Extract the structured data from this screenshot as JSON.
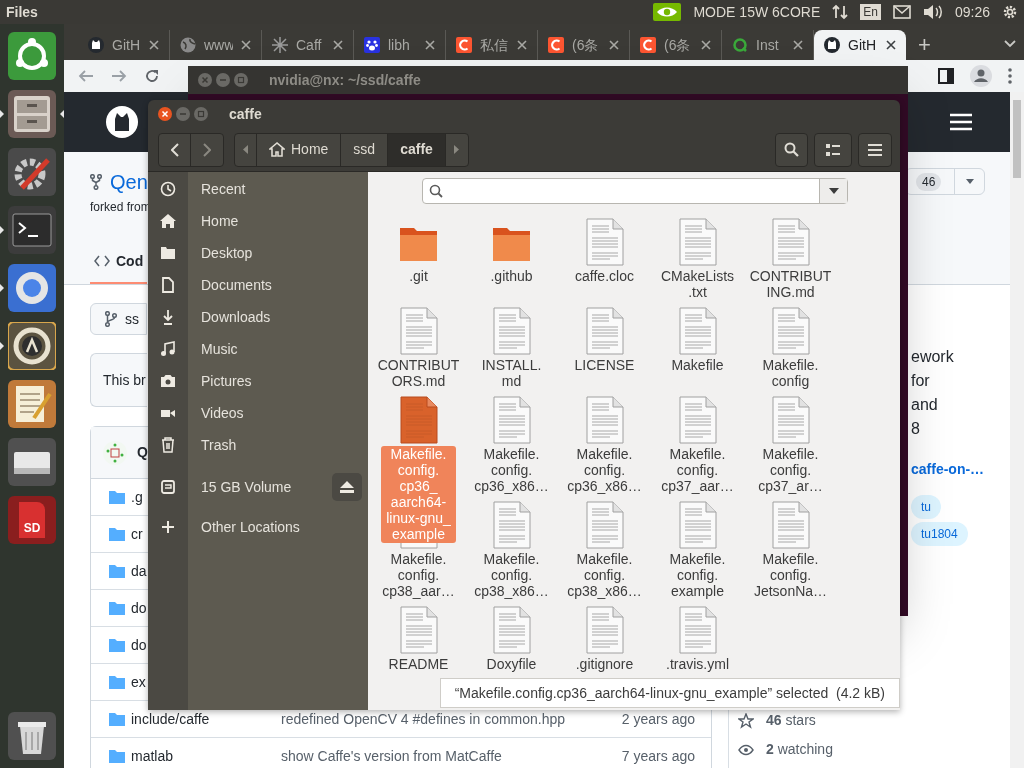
{
  "top_panel": {
    "app_name": "Files",
    "power_mode": "MODE 15W 6CORE",
    "input_method": "En",
    "clock": "09:26"
  },
  "launcher": [
    {
      "kind": "dash",
      "running": false,
      "focused": false
    },
    {
      "kind": "files",
      "running": true,
      "focused": true
    },
    {
      "kind": "settings",
      "running": false,
      "focused": false
    },
    {
      "kind": "terminal",
      "running": true,
      "focused": false
    },
    {
      "kind": "browser",
      "running": true,
      "focused": false
    },
    {
      "kind": "software",
      "running": true,
      "focused": false
    },
    {
      "kind": "editor",
      "running": false,
      "focused": false
    },
    {
      "kind": "drive",
      "running": false,
      "focused": false
    },
    {
      "kind": "sd",
      "label": "SD",
      "running": false,
      "focused": false
    }
  ],
  "browser": {
    "tabs": [
      {
        "title": "GitH",
        "kind": "github",
        "selected": false
      },
      {
        "title": "www",
        "kind": "globe",
        "selected": false
      },
      {
        "title": "Caff",
        "kind": "caffe",
        "selected": false
      },
      {
        "title": "libh",
        "kind": "paw",
        "selected": false
      },
      {
        "title": "私信",
        "kind": "csdn",
        "selected": false
      },
      {
        "title": "(6条",
        "kind": "csdn",
        "selected": false
      },
      {
        "title": "(6条",
        "kind": "csdn",
        "selected": false
      },
      {
        "title": "Inst",
        "kind": "ring",
        "selected": false
      },
      {
        "title": "GitH",
        "kind": "github",
        "selected": true
      }
    ],
    "new_tab": "+",
    "page": {
      "repo_name": "Qen",
      "forked_from": "forked from",
      "code_tab": "Cod",
      "branch": "ss",
      "notice": "This br",
      "commit_author": "Q",
      "files": [
        {
          "name": ".g"
        },
        {
          "name": "cr"
        },
        {
          "name": "da"
        },
        {
          "name": "do"
        },
        {
          "name": "do"
        },
        {
          "name": "ex"
        },
        {
          "name": "include/caffe",
          "message": "redefined OpenCV 4 #defines in common.hpp",
          "age": "2 years ago"
        },
        {
          "name": "matlab",
          "message": "show Caffe's version from MatCaffe",
          "age": "7 years ago"
        }
      ],
      "fork_count": "46",
      "about_lines": [
        "ework",
        "for",
        "and",
        "8"
      ],
      "link": "caffe-on-…",
      "topics": [
        "tu",
        "tu1804"
      ],
      "stars": "**46** stars",
      "watching": "**2** watching"
    }
  },
  "terminal": {
    "title": "nvidia@nx: ~/ssd/caffe"
  },
  "files": {
    "title": "caffe",
    "path": [
      {
        "label": "Home",
        "selected": false
      },
      {
        "label": "ssd",
        "selected": false
      },
      {
        "label": "caffe",
        "selected": true
      }
    ],
    "sidebar": [
      {
        "kind": "recent",
        "label": "Recent"
      },
      {
        "kind": "home",
        "label": "Home"
      },
      {
        "kind": "desktop",
        "label": "Desktop"
      },
      {
        "kind": "documents",
        "label": "Documents"
      },
      {
        "kind": "downloads",
        "label": "Downloads"
      },
      {
        "kind": "music",
        "label": "Music"
      },
      {
        "kind": "pictures",
        "label": "Pictures"
      },
      {
        "kind": "videos",
        "label": "Videos"
      },
      {
        "kind": "trash",
        "label": "Trash"
      },
      {
        "kind": "volume",
        "label": "15 GB Volume"
      },
      {
        "kind": "other",
        "label": "Other Locations"
      }
    ],
    "items": [
      {
        "kind": "folder",
        "label": ".git",
        "selected": false
      },
      {
        "kind": "folder",
        "label": ".github",
        "selected": false
      },
      {
        "kind": "file",
        "label": "caffe.cloc",
        "selected": false
      },
      {
        "kind": "file",
        "label": "CMakeLists\n.txt",
        "selected": false
      },
      {
        "kind": "file",
        "label": "CONTRIBUT\nING.md",
        "selected": false
      },
      {
        "kind": "file",
        "label": "CONTRIBUT\nORS.md",
        "selected": false
      },
      {
        "kind": "file",
        "label": "INSTALL.\nmd",
        "selected": false
      },
      {
        "kind": "file",
        "label": "LICENSE",
        "selected": false
      },
      {
        "kind": "file",
        "label": "Makefile",
        "selected": false
      },
      {
        "kind": "file",
        "label": "Makefile.\nconfig",
        "selected": false
      },
      {
        "kind": "file",
        "label": "Makefile.\nconfig.\ncp36_\naarch64-\nlinux-gnu_\nexample",
        "selected": true
      },
      {
        "kind": "file",
        "label": "Makefile.\nconfig.\ncp36_x86…",
        "selected": false
      },
      {
        "kind": "file",
        "label": "Makefile.\nconfig.\ncp36_x86…",
        "selected": false
      },
      {
        "kind": "file",
        "label": "Makefile.\nconfig.\ncp37_aar…",
        "selected": false
      },
      {
        "kind": "file",
        "label": "Makefile.\nconfig.\ncp37_ar…",
        "selected": false
      },
      {
        "kind": "file",
        "label": "Makefile.\nconfig.\ncp38_aar…",
        "selected": false
      },
      {
        "kind": "file",
        "label": "Makefile.\nconfig.\ncp38_x86…",
        "selected": false
      },
      {
        "kind": "file",
        "label": "Makefile.\nconfig.\ncp38_x86…",
        "selected": false
      },
      {
        "kind": "file",
        "label": "Makefile.\nconfig.\nexample",
        "selected": false
      },
      {
        "kind": "file",
        "label": "Makefile.\nconfig.\nJetsonNa…",
        "selected": false
      },
      {
        "kind": "file",
        "label": "README",
        "selected": false
      },
      {
        "kind": "file",
        "label": "Doxyfile",
        "selected": false
      },
      {
        "kind": "file",
        "label": ".gitignore",
        "selected": false
      },
      {
        "kind": "file",
        "label": ".travis.yml",
        "selected": false
      }
    ],
    "status": "“Makefile.config.cp36_aarch64-linux-gnu_example” selected  (4.2 kB)"
  }
}
